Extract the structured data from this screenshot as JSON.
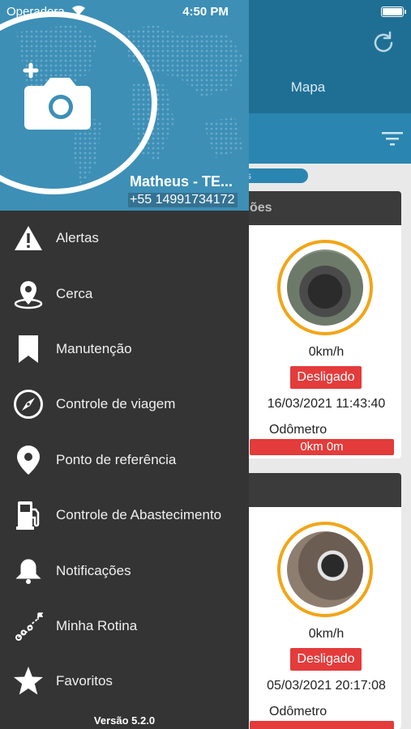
{
  "status_bar": {
    "carrier": "Operadora",
    "time": "4:50 PM"
  },
  "background": {
    "tab_label": "Mapa",
    "pill_text": "s",
    "cards": [
      {
        "header": "ões",
        "speed": "0km/h",
        "status": "Desligado",
        "datetime": "16/03/2021 11:43:40",
        "odometer_label": "Odômetro",
        "odometer_value": "0km 0m"
      },
      {
        "header": "",
        "speed": "0km/h",
        "status": "Desligado",
        "datetime": "05/03/2021 20:17:08",
        "odometer_label": "Odômetro",
        "odometer_value": ""
      }
    ],
    "colors": {
      "header": "#1f6f95",
      "status_red": "#e43b3b",
      "ring": "#f2a516"
    }
  },
  "drawer": {
    "user_name": "Matheus - TE...",
    "user_phone": "+55 14991734172",
    "menu": [
      {
        "label": "Alertas",
        "icon": "warning-icon"
      },
      {
        "label": "Cerca",
        "icon": "location-pin-icon"
      },
      {
        "label": "Manutenção",
        "icon": "bookmark-icon"
      },
      {
        "label": "Controle de viagem",
        "icon": "compass-icon"
      },
      {
        "label": "Ponto de referência",
        "icon": "map-pin-icon"
      },
      {
        "label": "Controle de Abastecimento",
        "icon": "fuel-pump-icon"
      },
      {
        "label": "Notificações",
        "icon": "bell-icon"
      },
      {
        "label": "Minha Rotina",
        "icon": "route-icon"
      },
      {
        "label": "Favoritos",
        "icon": "star-icon"
      }
    ],
    "version": "Versão 5.2.0",
    "colors": {
      "header": "#3d8fb6",
      "menu_bg": "#343434"
    }
  }
}
